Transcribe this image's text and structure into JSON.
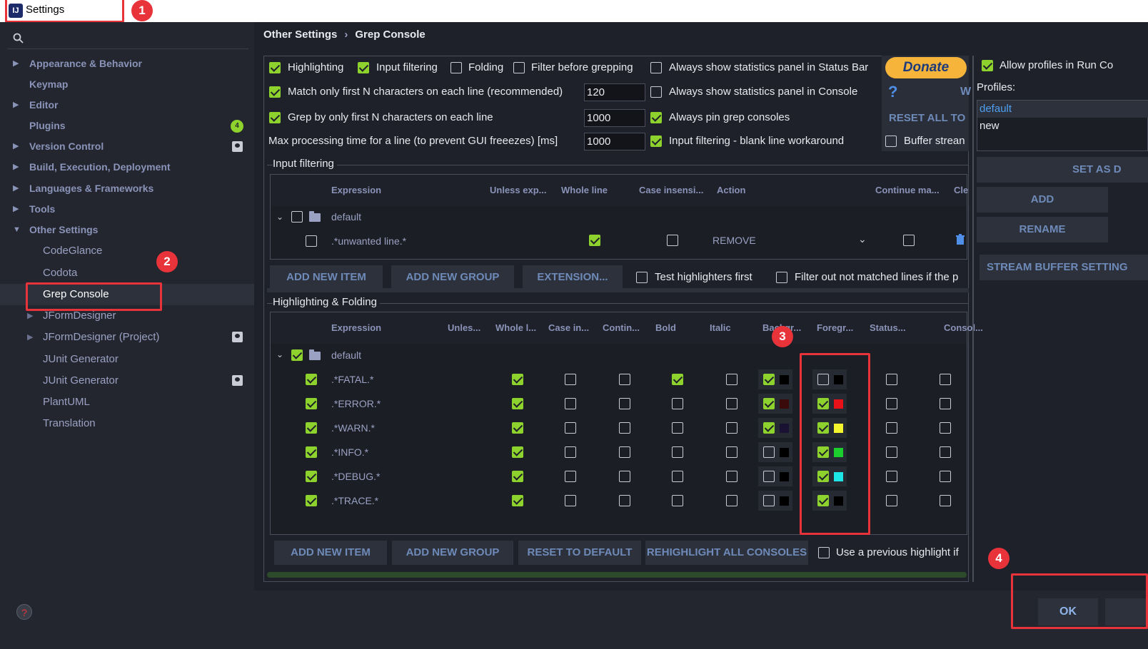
{
  "window": {
    "title": "Settings",
    "icon": "intellij-icon"
  },
  "annotations": {
    "marker1": "1",
    "marker2": "2",
    "marker3": "3",
    "marker4": "4"
  },
  "sidebar": {
    "items": [
      {
        "label": "Appearance & Behavior",
        "expandable": true
      },
      {
        "label": "Keymap",
        "expandable": false
      },
      {
        "label": "Editor",
        "expandable": true
      },
      {
        "label": "Plugins",
        "expandable": false,
        "badge": "4"
      },
      {
        "label": "Version Control",
        "expandable": true
      },
      {
        "label": "Build, Execution, Deployment",
        "expandable": true
      },
      {
        "label": "Languages & Frameworks",
        "expandable": true
      },
      {
        "label": "Tools",
        "expandable": true
      },
      {
        "label": "Other Settings",
        "expandable": true,
        "expanded": true
      }
    ],
    "subitems": [
      {
        "label": "CodeGlance"
      },
      {
        "label": "Codota"
      },
      {
        "label": "Grep Console",
        "selected": true
      },
      {
        "label": "JFormDesigner",
        "expandable": true
      },
      {
        "label": "JFormDesigner (Project)",
        "expandable": true
      },
      {
        "label": "JUnit Generator"
      },
      {
        "label": "JUnit Generator"
      },
      {
        "label": "PlantUML"
      },
      {
        "label": "Translation"
      }
    ]
  },
  "breadcrumb": {
    "parent": "Other Settings",
    "separator": "›",
    "current": "Grep Console"
  },
  "options": {
    "highlighting": "Highlighting",
    "input_filtering": "Input filtering",
    "folding": "Folding",
    "filter_before": "Filter before grepping",
    "always_stats_status": "Always show statistics panel in Status Bar",
    "match_first_n": "Match only first N characters on each line (recommended)",
    "match_first_n_value": "120",
    "always_stats_console": "Always show statistics panel in Console",
    "grep_first_n": "Grep by only first N characters on each line",
    "grep_first_n_value": "1000",
    "always_pin": "Always pin grep consoles",
    "max_time": "Max processing time for a line (to prevent GUI freeezes) [ms]",
    "max_time_value": "1000",
    "blank_line": "Input filtering - blank line workaround",
    "buffer_stream": "Buffer strean"
  },
  "donate": {
    "label": "Donate",
    "help": "?",
    "reset_all": "RESET ALL TO D",
    "w": "W"
  },
  "input_filtering": {
    "title": "Input filtering",
    "headers": [
      "Expression",
      "Unless exp...",
      "Whole line",
      "Case insensi...",
      "Action",
      "Continue ma...",
      "Cle"
    ],
    "group": "default",
    "row": {
      "expression": ".*unwanted line.*",
      "action": "REMOVE"
    },
    "buttons": {
      "add_item": "ADD NEW ITEM",
      "add_group": "ADD NEW GROUP",
      "extension": "EXTENSION..."
    },
    "test_first": "Test highlighters first",
    "filter_out": "Filter out not matched lines if the p"
  },
  "highlighting": {
    "title": "Highlighting & Folding",
    "headers": [
      "Expression",
      "Unles...",
      "Whole l...",
      "Case in...",
      "Contin...",
      "Bold",
      "Italic",
      "Backgr...",
      "Foregr...",
      "Status...",
      "Consol..."
    ],
    "group": "default",
    "rows": [
      {
        "expression": ".*FATAL.*",
        "bold": true,
        "bg_on": true,
        "bg_color": "#000000",
        "fg_on": false,
        "fg_color": "#000000"
      },
      {
        "expression": ".*ERROR.*",
        "bold": false,
        "bg_on": true,
        "bg_color": "#3a0a0a",
        "fg_on": true,
        "fg_color": "#e8111a"
      },
      {
        "expression": ".*WARN.*",
        "bold": false,
        "bg_on": true,
        "bg_color": "#1a1233",
        "fg_on": true,
        "fg_color": "#f5f52e"
      },
      {
        "expression": ".*INFO.*",
        "bold": false,
        "bg_on": false,
        "bg_color": "#000000",
        "fg_on": true,
        "fg_color": "#1ccf2e"
      },
      {
        "expression": ".*DEBUG.*",
        "bold": false,
        "bg_on": false,
        "bg_color": "#000000",
        "fg_on": true,
        "fg_color": "#1ce6e6"
      },
      {
        "expression": ".*TRACE.*",
        "bold": false,
        "bg_on": false,
        "bg_color": "#000000",
        "fg_on": true,
        "fg_color": "#000000"
      }
    ],
    "buttons": {
      "add_item": "ADD NEW ITEM",
      "add_group": "ADD NEW GROUP",
      "reset": "RESET TO DEFAULT",
      "rehighlight": "REHIGHLIGHT ALL CONSOLES"
    },
    "use_previous": "Use a previous highlight if"
  },
  "profiles": {
    "allow_profiles": "Allow profiles in Run Co",
    "label": "Profiles:",
    "items": [
      "default",
      "new"
    ],
    "buttons": {
      "set_as": "SET AS D",
      "add": "ADD",
      "rename": "RENAME",
      "stream": "STREAM BUFFER SETTING"
    }
  },
  "footer": {
    "ok": "OK",
    "help": "?"
  },
  "colors": {
    "accent_green": "#8ed22d",
    "annotation_red": "#e8333b"
  }
}
